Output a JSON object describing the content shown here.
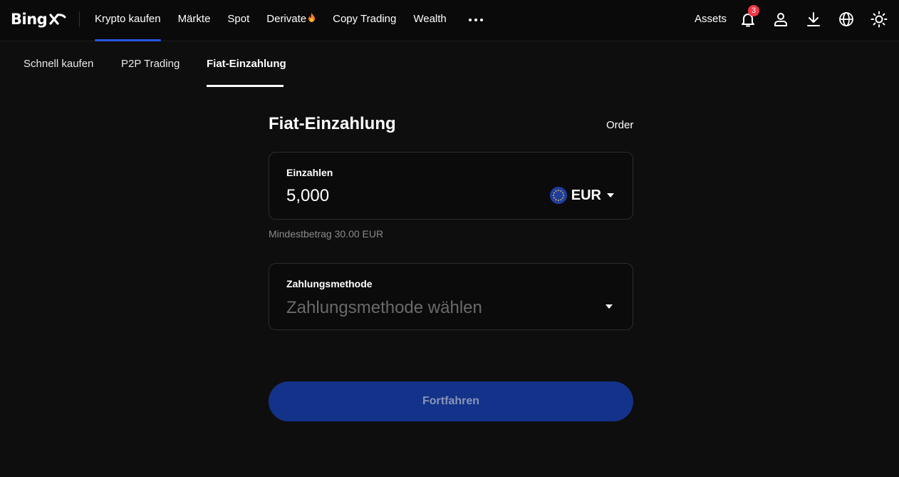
{
  "header": {
    "logo_text": "BingX",
    "nav": [
      {
        "label": "Krypto kaufen",
        "active": true
      },
      {
        "label": "Märkte"
      },
      {
        "label": "Spot"
      },
      {
        "label": "Derivate",
        "icon": "fire-icon"
      },
      {
        "label": "Copy Trading"
      },
      {
        "label": "Wealth"
      }
    ],
    "assets_label": "Assets",
    "notification_count": "3",
    "accent_color": "#2a55e5"
  },
  "subnav": {
    "items": [
      {
        "label": "Schnell kaufen"
      },
      {
        "label": "P2P Trading"
      },
      {
        "label": "Fiat-Einzahlung",
        "active": true
      }
    ]
  },
  "form": {
    "title": "Fiat-Einzahlung",
    "order_link": "Order",
    "amount": {
      "label": "Einzahlen",
      "value": "5,000",
      "currency": "EUR",
      "currency_icon": "eu-flag-icon"
    },
    "min_hint": "Mindestbetrag 30.00 EUR",
    "payment": {
      "label": "Zahlungsmethode",
      "placeholder": "Zahlungsmethode wählen"
    },
    "submit_label": "Fortfahren",
    "submit_color": "#13338a"
  }
}
